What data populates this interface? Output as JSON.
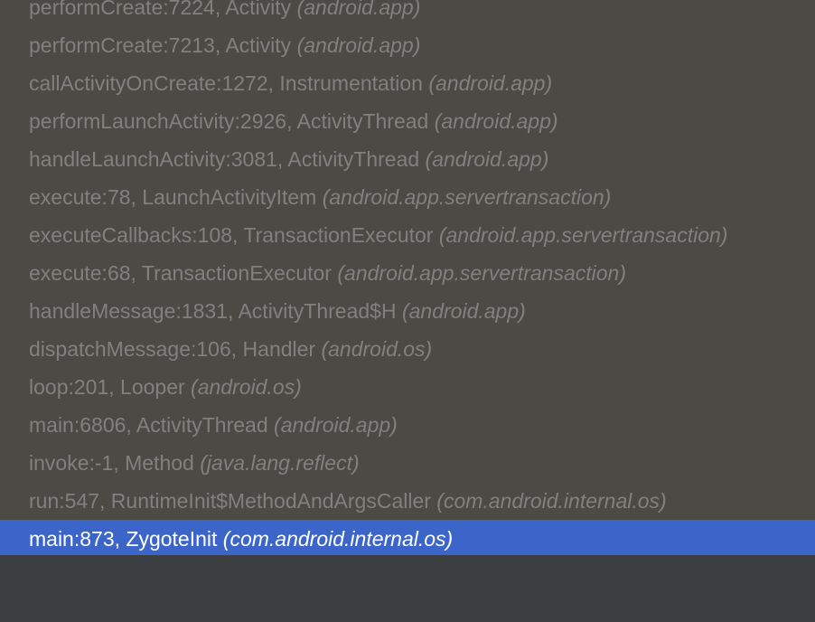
{
  "frames": [
    {
      "method": "performCreate:7224, Activity",
      "package": "(android.app)",
      "selected": false
    },
    {
      "method": "performCreate:7213, Activity",
      "package": "(android.app)",
      "selected": false
    },
    {
      "method": "callActivityOnCreate:1272, Instrumentation",
      "package": "(android.app)",
      "selected": false
    },
    {
      "method": "performLaunchActivity:2926, ActivityThread",
      "package": "(android.app)",
      "selected": false
    },
    {
      "method": "handleLaunchActivity:3081, ActivityThread",
      "package": "(android.app)",
      "selected": false
    },
    {
      "method": "execute:78, LaunchActivityItem",
      "package": "(android.app.servertransaction)",
      "selected": false
    },
    {
      "method": "executeCallbacks:108, TransactionExecutor",
      "package": "(android.app.servertransaction)",
      "selected": false
    },
    {
      "method": "execute:68, TransactionExecutor",
      "package": "(android.app.servertransaction)",
      "selected": false
    },
    {
      "method": "handleMessage:1831, ActivityThread$H",
      "package": "(android.app)",
      "selected": false
    },
    {
      "method": "dispatchMessage:106, Handler",
      "package": "(android.os)",
      "selected": false
    },
    {
      "method": "loop:201, Looper",
      "package": "(android.os)",
      "selected": false
    },
    {
      "method": "main:6806, ActivityThread",
      "package": "(android.app)",
      "selected": false
    },
    {
      "method": "invoke:-1, Method",
      "package": "(java.lang.reflect)",
      "selected": false
    },
    {
      "method": "run:547, RuntimeInit$MethodAndArgsCaller",
      "package": "(com.android.internal.os)",
      "selected": false
    },
    {
      "method": "main:873, ZygoteInit",
      "package": "(com.android.internal.os)",
      "selected": true
    }
  ],
  "colors": {
    "list_background": "#4b4a45",
    "panel_background": "#3c3f41",
    "frame_text": "#808080",
    "selection_background": "#3b65c9",
    "selection_text": "#ffffff"
  }
}
